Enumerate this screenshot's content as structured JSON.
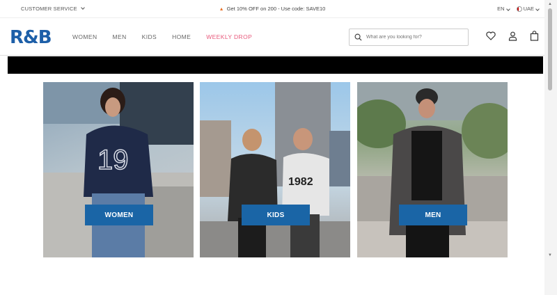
{
  "topbar": {
    "customer_service": "CUSTOMER SERVICE",
    "promo": "Get 10% OFF on 200 - Use code: SAVE10",
    "language": "EN",
    "country": "UAE"
  },
  "header": {
    "logo": "R&B",
    "nav": [
      "WOMEN",
      "MEN",
      "KIDS",
      "HOME",
      "WEEKLY DROP"
    ],
    "search_placeholder": "What are you looking for?"
  },
  "categories": [
    {
      "label": "WOMEN"
    },
    {
      "label": "KIDS"
    },
    {
      "label": "MEN"
    }
  ],
  "colors": {
    "brand": "#1d5fa8",
    "cta": "#1a65a6",
    "weekly_drop": "#e85a7c"
  }
}
